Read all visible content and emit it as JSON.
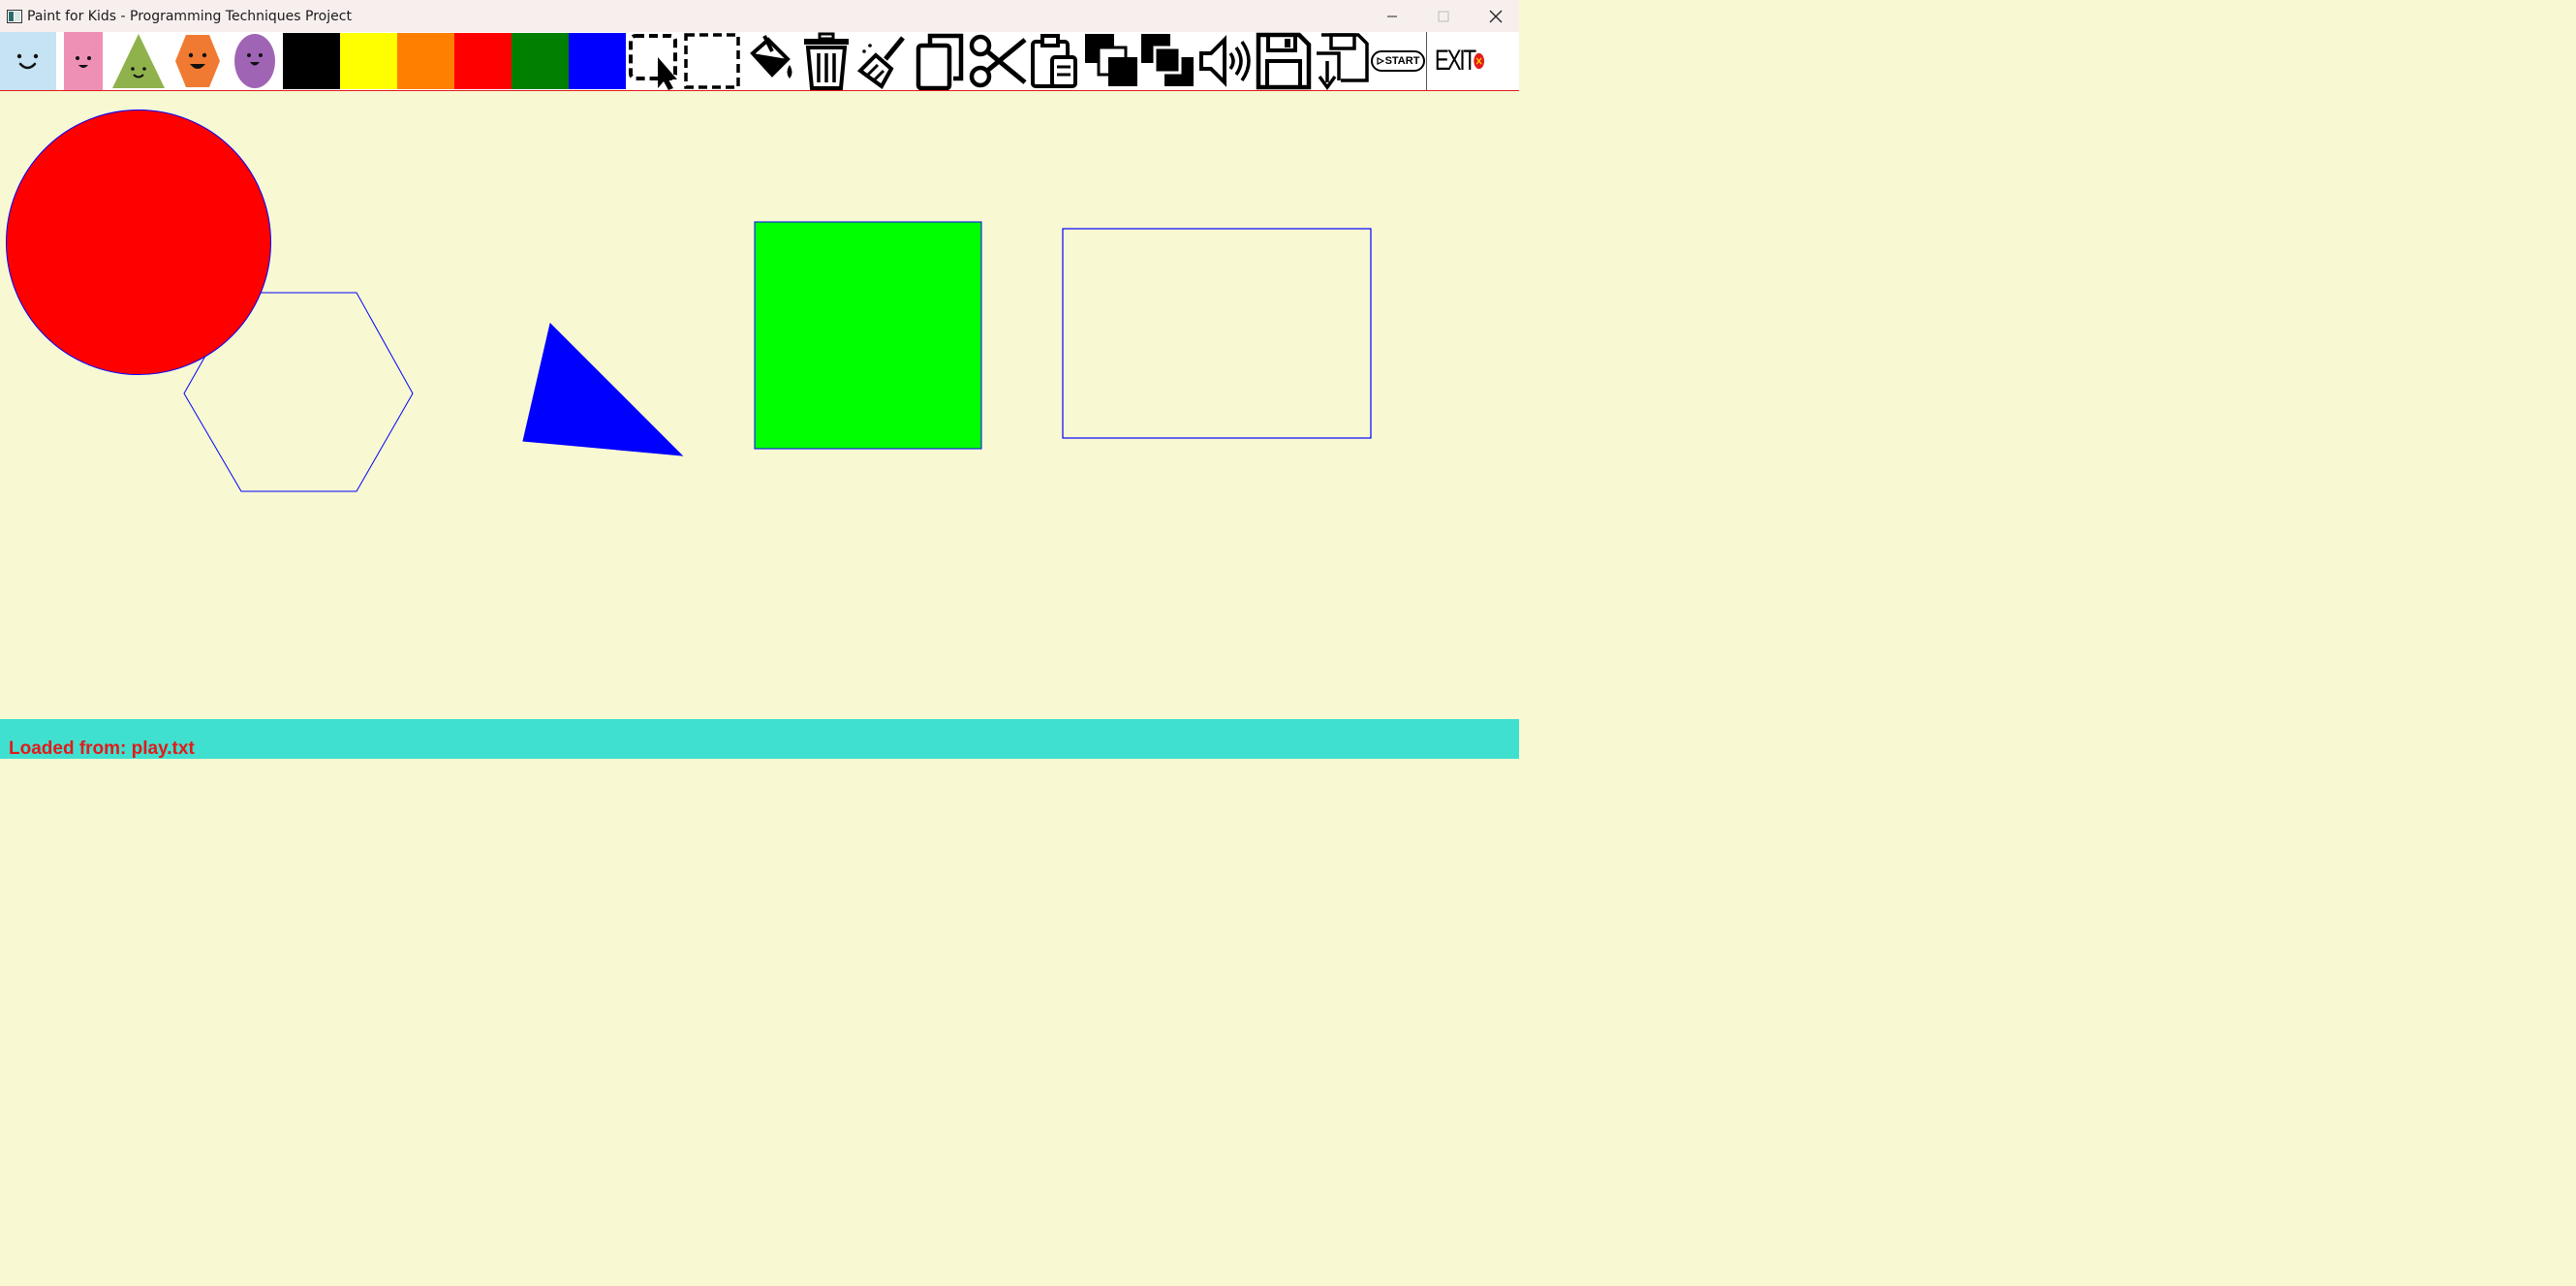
{
  "window": {
    "title": "Paint for Kids - Programming Techniques Project",
    "controls": [
      "minimize",
      "maximize",
      "close"
    ]
  },
  "toolbar": {
    "shape_tools": [
      {
        "icon": "square-face-icon",
        "label": "Square"
      },
      {
        "icon": "rectangle-face-icon",
        "label": "Rectangle"
      },
      {
        "icon": "triangle-face-icon",
        "label": "Triangle"
      },
      {
        "icon": "hexagon-face-icon",
        "label": "Hexagon"
      },
      {
        "icon": "circle-face-icon",
        "label": "Circle"
      }
    ],
    "colors": [
      "#000000",
      "#ffff00",
      "#ff7f00",
      "#ff0000",
      "#007f00",
      "#0000ff"
    ],
    "action_tools": [
      "select-icon",
      "multi-select-icon",
      "fill-bucket-icon",
      "delete-icon",
      "clear-all-brush-icon",
      "copy-icon",
      "cut-icon",
      "paste-icon",
      "send-to-back-icon",
      "bring-to-front-icon",
      "sound-icon",
      "save-icon",
      "load-icon"
    ],
    "start_label": "START",
    "exit_label": "EXIT",
    "colors_meta": {
      "border": "#e31a1a"
    }
  },
  "canvas": {
    "background": "#f8f8d2",
    "shapes": [
      {
        "type": "circle",
        "fill": "#ff0000",
        "stroke": "#0000ff"
      },
      {
        "type": "hexagon",
        "fill": "none",
        "stroke": "#0000ff"
      },
      {
        "type": "triangle",
        "fill": "#0000ff",
        "stroke": "#0000ff"
      },
      {
        "type": "square",
        "fill": "#00ff00",
        "stroke": "#0000ff"
      },
      {
        "type": "rectangle",
        "fill": "none",
        "stroke": "#0000ff"
      }
    ]
  },
  "status": {
    "text": "Loaded from: play.txt",
    "background": "#40e0d0",
    "color": "#e31a1a"
  }
}
